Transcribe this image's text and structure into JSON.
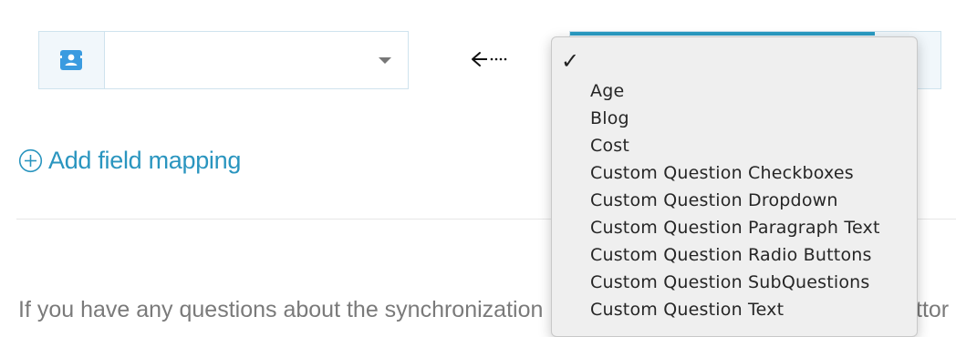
{
  "arrow_icon": "arrow-left-dotted-icon",
  "add_mapping": {
    "label": "Add field mapping",
    "icon": "plus-circle-icon"
  },
  "footer": {
    "text": "If you have any questions about the synchronization re",
    "tail": "ttor"
  },
  "dropdown": {
    "selected_mark": "✓",
    "options": [
      "Age",
      "Blog",
      "Cost",
      "Custom Question Checkboxes",
      "Custom Question Dropdown",
      "Custom Question Paragraph Text",
      "Custom Question Radio Buttons",
      "Custom Question SubQuestions",
      "Custom Question Text"
    ]
  },
  "colors": {
    "accent": "#2a95bf",
    "field_border": "#cfe3ee",
    "icon_bg": "#3a9be0"
  }
}
